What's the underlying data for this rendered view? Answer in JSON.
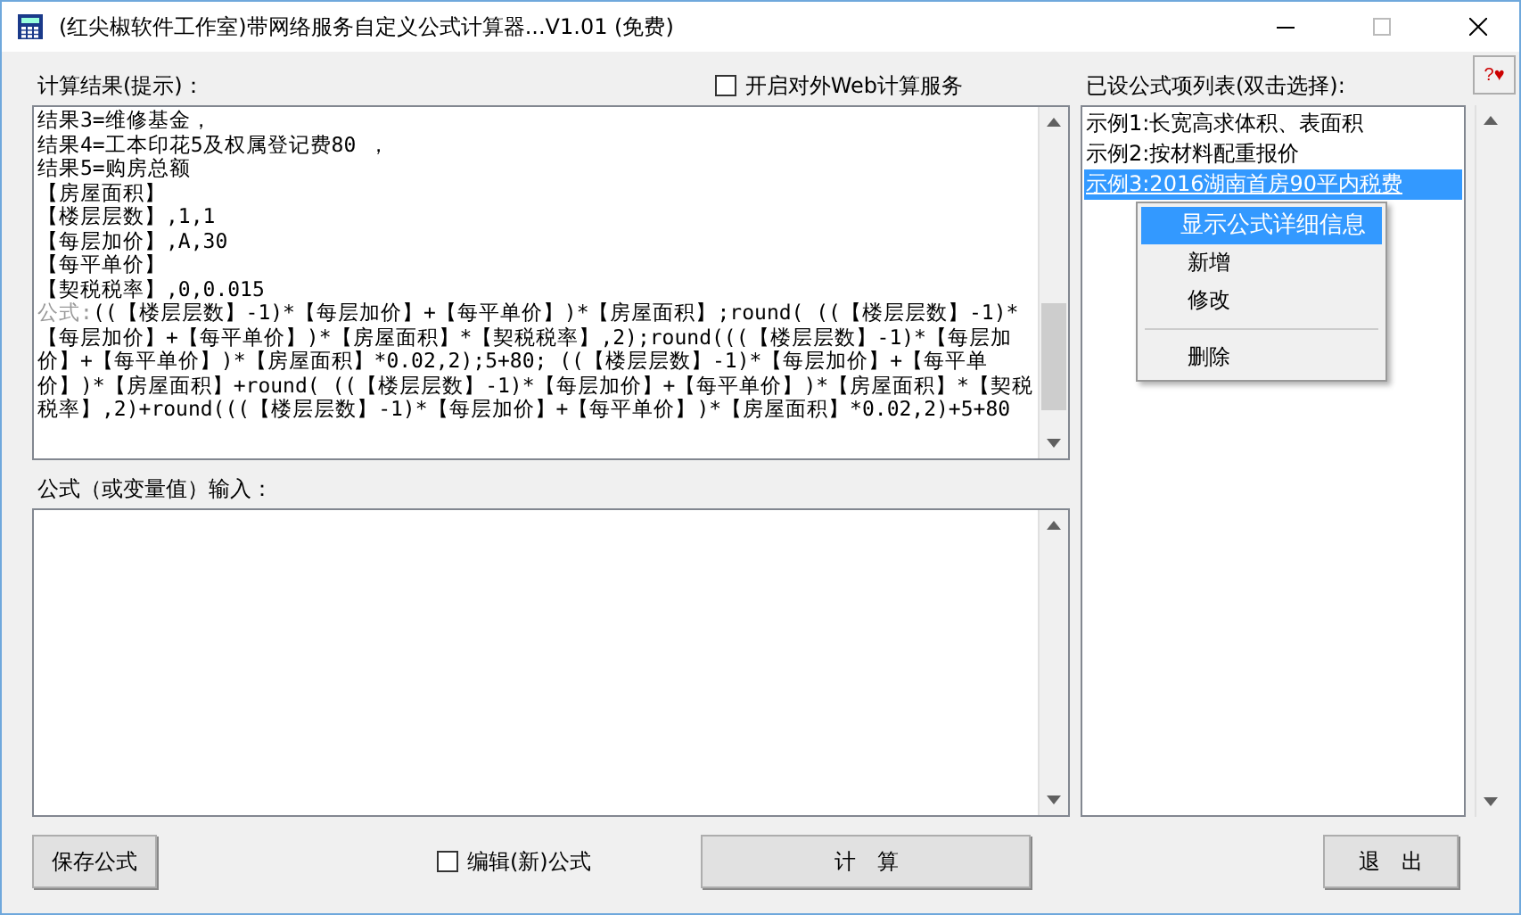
{
  "window": {
    "title": "(红尖椒软件工作室)带网络服务自定义公式计算器...V1.01 (免费)"
  },
  "help_button": {
    "question": "?",
    "heart": "♥"
  },
  "result": {
    "label": "计算结果(提示)：",
    "lines": [
      "结果3=维修基金，",
      "结果4=工本印花5及权属登记费80 ，",
      "结果5=购房总额",
      "【房屋面积】",
      "【楼层层数】,1,1",
      "【每层加价】,A,30",
      "【每平单价】",
      "【契税税率】,0,0.015"
    ],
    "formula": {
      "label": "公式:",
      "text": "((【楼层层数】-1)*【每层加价】+【每平单价】)*【房屋面积】;round( ((【楼层层数】-1)*【每层加价】+【每平单价】)*【房屋面积】*【契税税率】,2);round(((【楼层层数】-1)*【每层加价】+【每平单价】)*【房屋面积】*0.02,2);5+80; ((【楼层层数】-1)*【每层加价】+【每平单价】)*【房屋面积】+round( ((【楼层层数】-1)*【每层加价】+【每平单价】)*【房屋面积】*【契税税率】,2)+round(((【楼层层数】-1)*【每层加价】+【每平单价】)*【房屋面积】*0.02,2)+5+80"
    }
  },
  "web_service": {
    "label": "开启对外Web计算服务",
    "checked": false
  },
  "input": {
    "label": "公式（或变量值）输入："
  },
  "formula_list": {
    "label": "已设公式项列表(双击选择):",
    "items": [
      {
        "label": "示例1:长宽高求体积、表面积",
        "selected": false
      },
      {
        "label": "示例2:按材料配重报价",
        "selected": false
      },
      {
        "label": "示例3:2016湖南首房90平内税费",
        "selected": true
      }
    ]
  },
  "context_menu": [
    {
      "kind": "item",
      "label": "显示公式详细信息",
      "selected": true
    },
    {
      "kind": "item",
      "label": "新增",
      "selected": false
    },
    {
      "kind": "item",
      "label": "修改",
      "selected": false
    },
    {
      "kind": "separator"
    },
    {
      "kind": "item",
      "label": "删除",
      "selected": false
    }
  ],
  "buttons": {
    "save": "保存公式",
    "calculate": "计　算",
    "exit": "退　出"
  },
  "edit_new": {
    "label": "编辑(新)公式",
    "checked": false
  }
}
